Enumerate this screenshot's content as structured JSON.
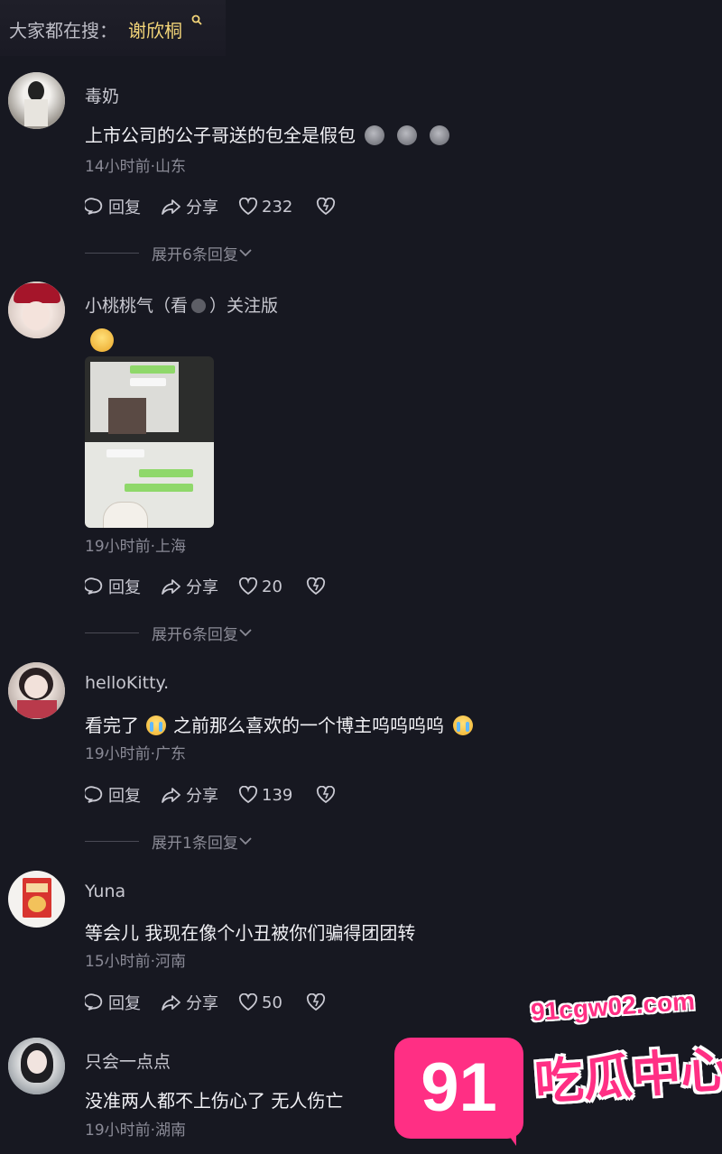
{
  "search": {
    "prefix": "大家都在搜：",
    "term": "谢欣桐"
  },
  "action_labels": {
    "reply": "回复",
    "share": "分享"
  },
  "comments": [
    {
      "name": "毒奶",
      "text": "上市公司的公子哥送的包全是假包",
      "meta": "14小时前·山东",
      "likes": "232",
      "expand": "展开6条回复"
    },
    {
      "name": "小桃桃气（看",
      "name_suffix": "）关注版",
      "text": "",
      "meta": "19小时前·上海",
      "likes": "20",
      "expand": "展开6条回复"
    },
    {
      "name": "helloKitty.",
      "text_a": "看完了",
      "text_b": "之前那么喜欢的一个博主呜呜呜呜",
      "meta": "19小时前·广东",
      "likes": "139",
      "expand": "展开1条回复"
    },
    {
      "name": "Yuna",
      "text": "等会儿 我现在像个小丑被你们骗得团团转",
      "meta": "15小时前·河南",
      "likes": "50"
    },
    {
      "name": "只会一点点",
      "text": "没准两人都不上伤心了  无人伤亡",
      "meta": "19小时前·湖南"
    }
  ],
  "watermark": {
    "number": "91",
    "domain": "91cgw02.com",
    "brand": "吃瓜中心"
  },
  "colors": {
    "background": "#171821",
    "accent_search": "#f2d478",
    "watermark": "#ff2f84"
  }
}
